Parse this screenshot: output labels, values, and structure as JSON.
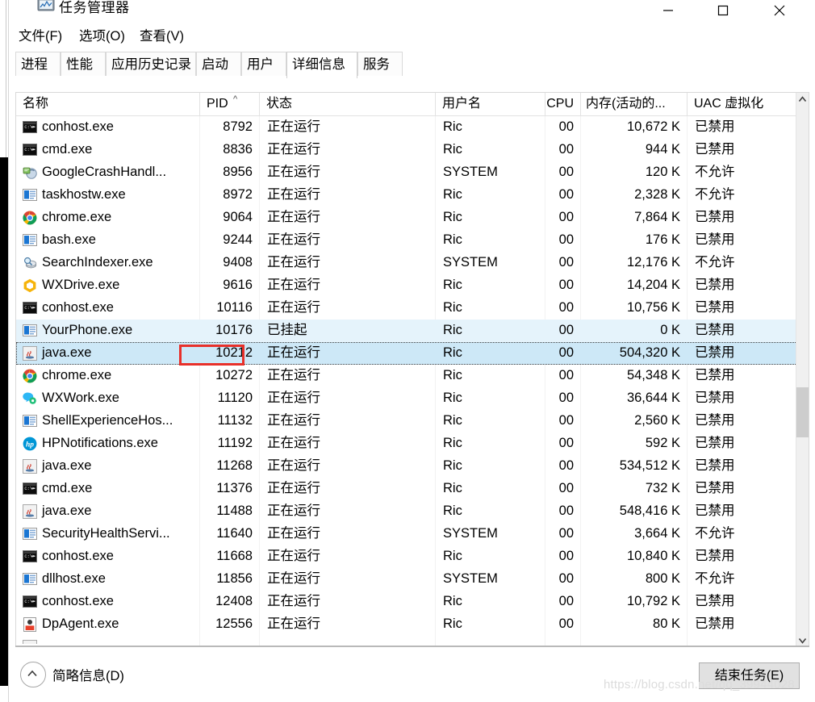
{
  "window": {
    "title": "任务管理器",
    "icon": "task-manager-icon",
    "minimize_label": "最小化",
    "maximize_label": "最大化",
    "close_label": "关闭"
  },
  "menu": [
    {
      "label": "文件(F)",
      "accel": "F"
    },
    {
      "label": "选项(O)",
      "accel": "O"
    },
    {
      "label": "查看(V)",
      "accel": "V"
    }
  ],
  "tabs": [
    {
      "label": "进程",
      "active": false
    },
    {
      "label": "性能",
      "active": false
    },
    {
      "label": "应用历史记录",
      "active": false
    },
    {
      "label": "启动",
      "active": false
    },
    {
      "label": "用户",
      "active": false
    },
    {
      "label": "详细信息",
      "active": true
    },
    {
      "label": "服务",
      "active": false
    }
  ],
  "table": {
    "columns": [
      {
        "key": "name",
        "label": "名称",
        "align": "left"
      },
      {
        "key": "pid",
        "label": "PID",
        "align": "right",
        "sorted": "asc",
        "sort_glyph": "^"
      },
      {
        "key": "status",
        "label": "状态",
        "align": "left"
      },
      {
        "key": "user",
        "label": "用户名",
        "align": "left"
      },
      {
        "key": "cpu",
        "label": "CPU",
        "align": "right"
      },
      {
        "key": "memory",
        "label": "内存(活动的...",
        "align": "right"
      },
      {
        "key": "uac",
        "label": "UAC 虚拟化",
        "align": "left"
      }
    ],
    "rows": [
      {
        "icon": "console-icon",
        "name": "conhost.exe",
        "pid": "8792",
        "status": "正在运行",
        "user": "Ric",
        "cpu": "00",
        "memory": "10,672 K",
        "uac": "已禁用",
        "state": "normal"
      },
      {
        "icon": "console-icon",
        "name": "cmd.exe",
        "pid": "8836",
        "status": "正在运行",
        "user": "Ric",
        "cpu": "00",
        "memory": "944 K",
        "uac": "已禁用",
        "state": "normal"
      },
      {
        "icon": "crash-icon",
        "name": "GoogleCrashHandl...",
        "pid": "8956",
        "status": "正在运行",
        "user": "SYSTEM",
        "cpu": "00",
        "memory": "120 K",
        "uac": "不允许",
        "state": "normal"
      },
      {
        "icon": "app-icon",
        "name": "taskhostw.exe",
        "pid": "8972",
        "status": "正在运行",
        "user": "Ric",
        "cpu": "00",
        "memory": "2,328 K",
        "uac": "不允许",
        "state": "normal"
      },
      {
        "icon": "chrome-icon",
        "name": "chrome.exe",
        "pid": "9064",
        "status": "正在运行",
        "user": "Ric",
        "cpu": "00",
        "memory": "7,864 K",
        "uac": "已禁用",
        "state": "normal"
      },
      {
        "icon": "app-icon",
        "name": "bash.exe",
        "pid": "9244",
        "status": "正在运行",
        "user": "Ric",
        "cpu": "00",
        "memory": "176 K",
        "uac": "已禁用",
        "state": "normal"
      },
      {
        "icon": "search-icon",
        "name": "SearchIndexer.exe",
        "pid": "9408",
        "status": "正在运行",
        "user": "SYSTEM",
        "cpu": "00",
        "memory": "12,176 K",
        "uac": "不允许",
        "state": "normal"
      },
      {
        "icon": "wxdrive-icon",
        "name": "WXDrive.exe",
        "pid": "9616",
        "status": "正在运行",
        "user": "Ric",
        "cpu": "00",
        "memory": "14,204 K",
        "uac": "已禁用",
        "state": "normal"
      },
      {
        "icon": "console-icon",
        "name": "conhost.exe",
        "pid": "10116",
        "status": "正在运行",
        "user": "Ric",
        "cpu": "00",
        "memory": "10,756 K",
        "uac": "已禁用",
        "state": "normal"
      },
      {
        "icon": "app-icon",
        "name": "YourPhone.exe",
        "pid": "10176",
        "status": "已挂起",
        "user": "Ric",
        "cpu": "00",
        "memory": "0 K",
        "uac": "已禁用",
        "state": "selected-soft"
      },
      {
        "icon": "java-icon",
        "name": "java.exe",
        "pid": "10212",
        "status": "正在运行",
        "user": "Ric",
        "cpu": "00",
        "memory": "504,320 K",
        "uac": "已禁用",
        "state": "selected-focus"
      },
      {
        "icon": "chrome-icon",
        "name": "chrome.exe",
        "pid": "10272",
        "status": "正在运行",
        "user": "Ric",
        "cpu": "00",
        "memory": "54,348 K",
        "uac": "已禁用",
        "state": "normal"
      },
      {
        "icon": "wxwork-icon",
        "name": "WXWork.exe",
        "pid": "11120",
        "status": "正在运行",
        "user": "Ric",
        "cpu": "00",
        "memory": "36,644 K",
        "uac": "已禁用",
        "state": "normal"
      },
      {
        "icon": "app-icon",
        "name": "ShellExperienceHos...",
        "pid": "11132",
        "status": "正在运行",
        "user": "Ric",
        "cpu": "00",
        "memory": "2,560 K",
        "uac": "已禁用",
        "state": "normal"
      },
      {
        "icon": "hp-icon",
        "name": "HPNotifications.exe",
        "pid": "11192",
        "status": "正在运行",
        "user": "Ric",
        "cpu": "00",
        "memory": "592 K",
        "uac": "已禁用",
        "state": "normal"
      },
      {
        "icon": "java-icon",
        "name": "java.exe",
        "pid": "11268",
        "status": "正在运行",
        "user": "Ric",
        "cpu": "00",
        "memory": "534,512 K",
        "uac": "已禁用",
        "state": "normal"
      },
      {
        "icon": "console-icon",
        "name": "cmd.exe",
        "pid": "11376",
        "status": "正在运行",
        "user": "Ric",
        "cpu": "00",
        "memory": "732 K",
        "uac": "已禁用",
        "state": "normal"
      },
      {
        "icon": "java-icon",
        "name": "java.exe",
        "pid": "11488",
        "status": "正在运行",
        "user": "Ric",
        "cpu": "00",
        "memory": "548,416 K",
        "uac": "已禁用",
        "state": "normal"
      },
      {
        "icon": "app-icon",
        "name": "SecurityHealthServi...",
        "pid": "11640",
        "status": "正在运行",
        "user": "SYSTEM",
        "cpu": "00",
        "memory": "3,664 K",
        "uac": "不允许",
        "state": "normal"
      },
      {
        "icon": "console-icon",
        "name": "conhost.exe",
        "pid": "11668",
        "status": "正在运行",
        "user": "Ric",
        "cpu": "00",
        "memory": "10,840 K",
        "uac": "已禁用",
        "state": "normal"
      },
      {
        "icon": "app-icon",
        "name": "dllhost.exe",
        "pid": "11856",
        "status": "正在运行",
        "user": "SYSTEM",
        "cpu": "00",
        "memory": "800 K",
        "uac": "不允许",
        "state": "normal"
      },
      {
        "icon": "console-icon",
        "name": "conhost.exe",
        "pid": "12408",
        "status": "正在运行",
        "user": "Ric",
        "cpu": "00",
        "memory": "10,792 K",
        "uac": "已禁用",
        "state": "normal"
      },
      {
        "icon": "dpagent-icon",
        "name": "DpAgent.exe",
        "pid": "12556",
        "status": "正在运行",
        "user": "Ric",
        "cpu": "00",
        "memory": "80 K",
        "uac": "已禁用",
        "state": "normal"
      }
    ]
  },
  "scrollbar": {
    "up_label": "向上滚动",
    "down_label": "向下滚动"
  },
  "footer": {
    "fewer_details_label": "简略信息(D)",
    "fewer_details_icon": "chevron-up-circle-icon",
    "end_task_label": "结束任务(E)"
  },
  "annotation": {
    "highlight_target_pid": "10212",
    "highlight_color": "#e8302a"
  },
  "watermark": {
    "text": "https://blog.csdn.net/qq_39944028"
  }
}
